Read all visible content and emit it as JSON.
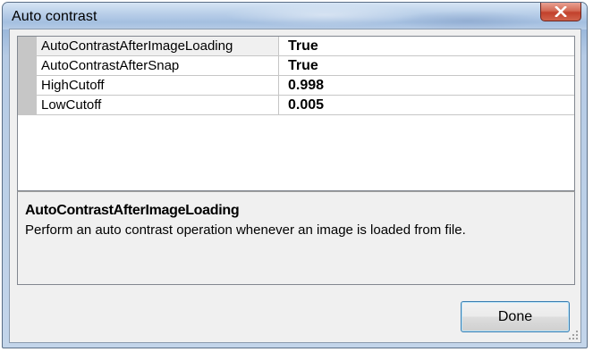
{
  "window": {
    "title": "Auto contrast"
  },
  "properties": [
    {
      "name": "AutoContrastAfterImageLoading",
      "value": "True"
    },
    {
      "name": "AutoContrastAfterSnap",
      "value": "True"
    },
    {
      "name": "HighCutoff",
      "value": "0.998"
    },
    {
      "name": "LowCutoff",
      "value": "0.005"
    }
  ],
  "description": {
    "title": "AutoContrastAfterImageLoading",
    "text": "Perform an auto contrast operation whenever an image is loaded from file."
  },
  "buttons": {
    "done_label": "Done"
  },
  "icons": {
    "close": "close-icon",
    "resize": "resize-grip-icon"
  },
  "colors": {
    "close_button": "#c2412c",
    "grid_gutter": "#c6c6c6",
    "focus_border": "#3c7fb1"
  }
}
